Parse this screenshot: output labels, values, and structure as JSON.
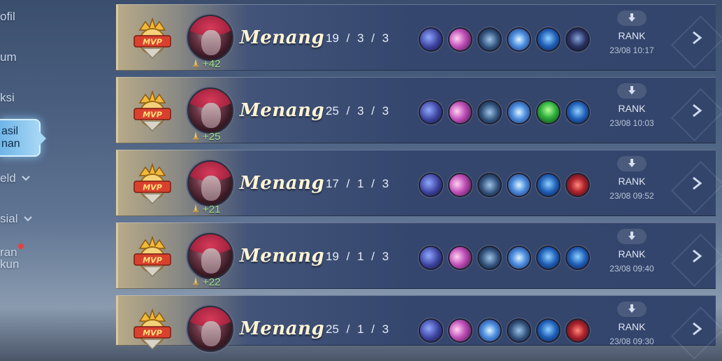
{
  "sidebar": {
    "items": [
      {
        "label": "ofil"
      },
      {
        "label": "um"
      },
      {
        "label": "ksi"
      },
      {
        "label": "asil\nnan",
        "active": true
      },
      {
        "label": "eld"
      },
      {
        "label": "sial"
      },
      {
        "label": "ran\nkun"
      }
    ]
  },
  "matches": [
    {
      "result": "Menang",
      "kills": "19",
      "deaths": "3",
      "assists": "3",
      "points": "+42",
      "mode": "RANK",
      "time": "23/08 10:17",
      "items": [
        "boots-icon",
        "crescent-orb-icon",
        "sword-ring-icon",
        "lightning-orb-icon",
        "blue-crystal-icon",
        "dark-spike-icon"
      ]
    },
    {
      "result": "Menang",
      "kills": "25",
      "deaths": "3",
      "assists": "3",
      "points": "+25",
      "mode": "RANK",
      "time": "23/08 10:03",
      "items": [
        "boots-icon",
        "crescent-orb-icon",
        "sword-ring-icon",
        "lightning-orb-icon",
        "green-gem-icon",
        "blue-crystal-icon"
      ]
    },
    {
      "result": "Menang",
      "kills": "17",
      "deaths": "1",
      "assists": "3",
      "points": "+21",
      "mode": "RANK",
      "time": "23/08 09:52",
      "items": [
        "boots-icon",
        "crescent-orb-icon",
        "sword-ring-icon",
        "lightning-orb-icon",
        "blue-crystal-icon",
        "red-book-icon"
      ]
    },
    {
      "result": "Menang",
      "kills": "19",
      "deaths": "1",
      "assists": "3",
      "points": "+22",
      "mode": "RANK",
      "time": "23/08 09:40",
      "items": [
        "boots-icon",
        "crescent-orb-icon",
        "sword-ring-icon",
        "lightning-orb-icon",
        "blue-crystal-icon",
        "blue-crystal-icon"
      ]
    },
    {
      "result": "Menang",
      "kills": "25",
      "deaths": "1",
      "assists": "3",
      "points": "",
      "mode": "RANK",
      "time": "23/08 09:30",
      "items": [
        "boots-icon",
        "crescent-orb-icon",
        "lightning-orb-icon",
        "sword-ring-icon",
        "blue-crystal-icon",
        "red-book-icon"
      ]
    }
  ],
  "badge": {
    "label": "MVP"
  },
  "colors": {
    "card_bg": "#34466d",
    "win_text": "#fff4d6",
    "points": "#9ee58a",
    "accent": "#a6d6f5"
  }
}
